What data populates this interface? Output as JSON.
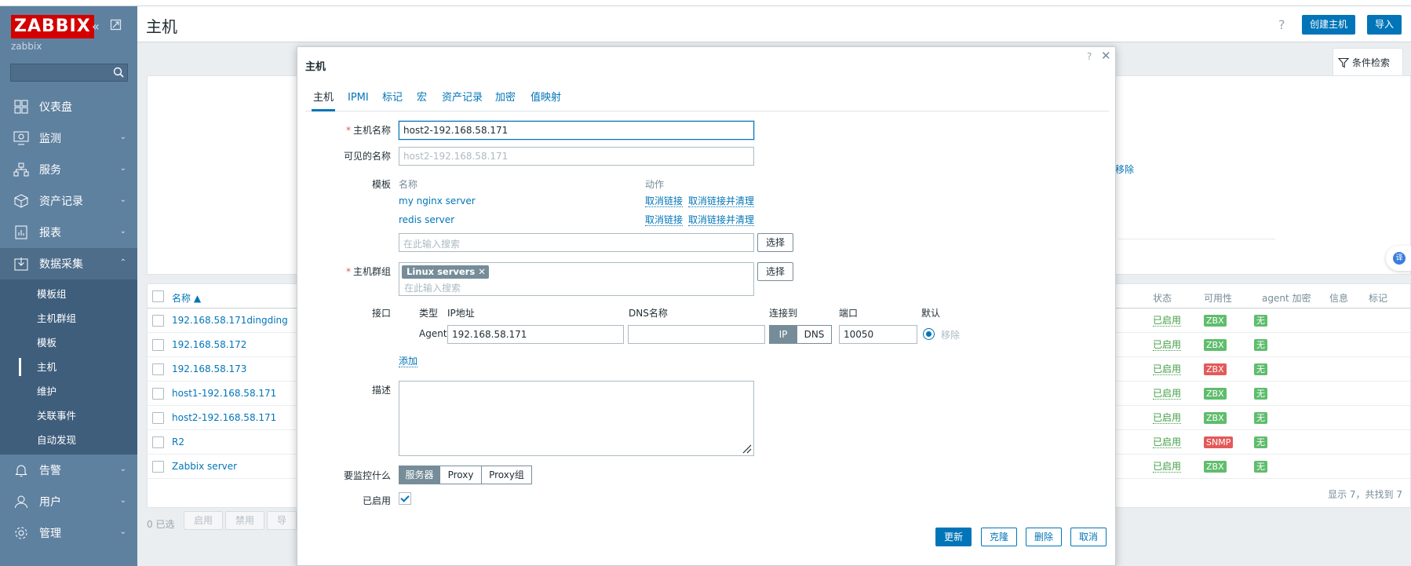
{
  "sidebar": {
    "logo": "ZABBIX",
    "brand_sub": "zabbix",
    "collapse_icon": "double-chevron-left-icon",
    "kiosk_icon": "kiosk-mode-icon",
    "search_placeholder": "",
    "items": [
      {
        "label": "仪表盘",
        "icon": "dashboard-icon"
      },
      {
        "label": "监测",
        "icon": "monitoring-icon"
      },
      {
        "label": "服务",
        "icon": "services-icon"
      },
      {
        "label": "资产记录",
        "icon": "inventory-icon"
      },
      {
        "label": "报表",
        "icon": "reports-icon"
      },
      {
        "label": "数据采集",
        "icon": "data-collection-icon"
      },
      {
        "label": "告警",
        "icon": "alerts-bell-icon"
      },
      {
        "label": "用户",
        "icon": "users-icon"
      },
      {
        "label": "管理",
        "icon": "administration-gear-icon"
      }
    ],
    "subitems": [
      "模板组",
      "主机群组",
      "模板",
      "主机",
      "维护",
      "关联事件",
      "自动发现"
    ],
    "active_subitem": "主机"
  },
  "page": {
    "title": "主机",
    "help": "?",
    "create_host": "创建主机",
    "import": "导入",
    "filter_tab": "条件检索",
    "filter_remove": "移除"
  },
  "table": {
    "columns": {
      "name": "名称 ▲",
      "status": "状态",
      "availability": "可用性",
      "agent_encryption": "agent 加密",
      "info": "信息",
      "tags": "标记"
    },
    "rows": [
      {
        "name": "192.168.58.171dingding",
        "status": "已启用",
        "avail": "ZBX",
        "avail_color": "green",
        "enc": "无"
      },
      {
        "name": "192.168.58.172",
        "status": "已启用",
        "avail": "ZBX",
        "avail_color": "green",
        "enc": "无"
      },
      {
        "name": "192.168.58.173",
        "status": "已启用",
        "avail": "ZBX",
        "avail_color": "red",
        "enc": "无"
      },
      {
        "name": "host1-192.168.58.171",
        "status": "已启用",
        "avail": "ZBX",
        "avail_color": "green",
        "enc": "无"
      },
      {
        "name": "host2-192.168.58.171",
        "status": "已启用",
        "avail": "ZBX",
        "avail_color": "green",
        "enc": "无"
      },
      {
        "name": "R2",
        "status": "已启用",
        "avail": "SNMP",
        "avail_color": "red",
        "enc": "无"
      },
      {
        "name": "Zabbix server",
        "status": "已启用",
        "avail": "ZBX",
        "avail_color": "green",
        "enc": "无"
      }
    ],
    "footer": "显示 7，共找到 7"
  },
  "bulk": {
    "selected": "0 已选",
    "enable": "启用",
    "disable": "禁用",
    "export": "导"
  },
  "modal": {
    "title": "主机",
    "help": "?",
    "close": "✕",
    "tabs": [
      "主机",
      "IPMI",
      "标记",
      "宏",
      "资产记录",
      "加密",
      "值映射"
    ],
    "active_tab": "主机",
    "host_name_label": "主机名称",
    "host_name_value": "host2-192.168.58.171",
    "visible_name_label": "可见的名称",
    "visible_name_placeholder": "host2-192.168.58.171",
    "templates_label": "模板",
    "templates_col_name": "名称",
    "templates_col_action": "动作",
    "templates": [
      {
        "name": "my nginx server",
        "unlink": "取消链接",
        "unlink_clear": "取消链接并清理"
      },
      {
        "name": "redis server",
        "unlink": "取消链接",
        "unlink_clear": "取消链接并清理"
      }
    ],
    "template_search_placeholder": "在此输入搜索",
    "select_button": "选择",
    "host_groups_label": "主机群组",
    "host_group_chip": "Linux servers",
    "host_group_search_placeholder": "在此输入搜索",
    "interfaces_label": "接口",
    "iface_cols": {
      "type": "类型",
      "ip": "IP地址",
      "dns": "DNS名称",
      "connect": "连接到",
      "port": "端口",
      "default": "默认"
    },
    "iface": {
      "type": "Agent",
      "ip": "192.168.58.171",
      "dns": "",
      "conn_ip": "IP",
      "conn_dns": "DNS",
      "port": "10050",
      "remove": "移除"
    },
    "add_link": "添加",
    "description_label": "描述",
    "monitored_by_label": "要监控什么",
    "monitored_by": [
      "服务器",
      "Proxy",
      "Proxy组"
    ],
    "monitored_by_selected": "服务器",
    "enabled_label": "已启用",
    "enabled": true,
    "buttons": {
      "update": "更新",
      "clone": "克隆",
      "delete": "删除",
      "cancel": "取消"
    }
  },
  "floating_widget": "译",
  "colors": {
    "sidebar": "#5f81a0",
    "accent": "#0275b8",
    "brand_red": "#d40000",
    "ok_green": "#429e47",
    "badge_green": "#5fbd6d",
    "badge_red": "#e45959"
  }
}
